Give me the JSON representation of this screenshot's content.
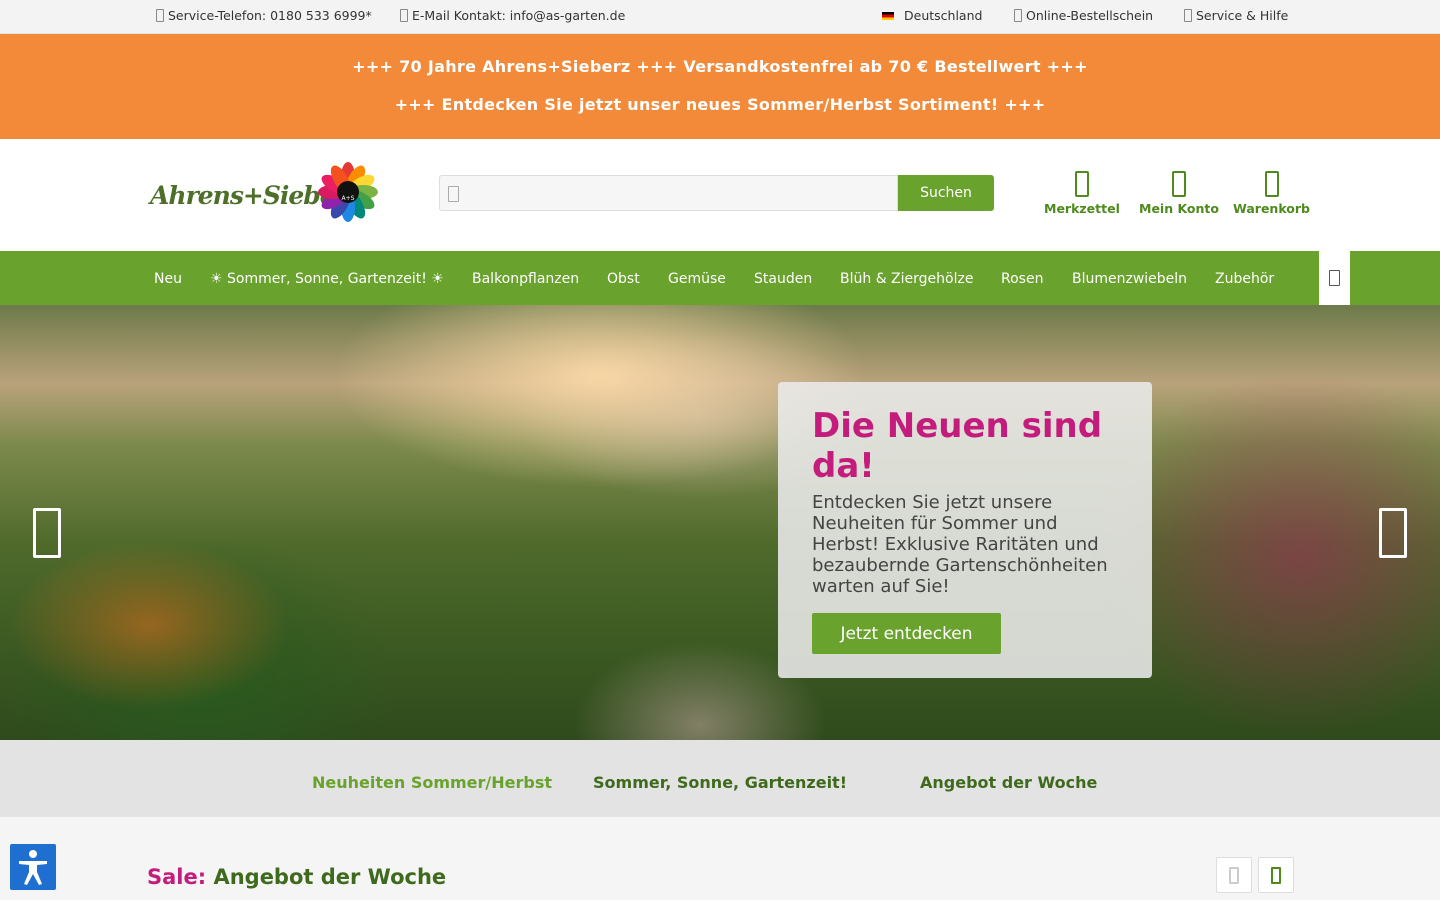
{
  "topbar": {
    "phone": "Service-Telefon: 0180 533 6999*",
    "email": "E-Mail Kontakt: info@as-garten.de",
    "country": "Deutschland",
    "order_form": "Online-Bestellschein",
    "service": "Service & Hilfe"
  },
  "promo": {
    "line1": "+++ 70 Jahre Ahrens+Sieberz +++ Versandkostenfrei ab 70 € Bestellwert +++",
    "line2": "+++ Entdecken Sie jetzt unser neues Sommer/Herbst Sortiment! +++"
  },
  "header": {
    "logo_text": "Ahrens+Sieberz",
    "logo_badge": "A+S",
    "search_placeholder": "",
    "search_button": "Suchen",
    "actions": [
      "Merkzettel",
      "Mein Konto",
      "Warenkorb"
    ]
  },
  "nav": {
    "items": [
      "Neu",
      "☀ Sommer, Sonne, Gartenzeit! ☀",
      "Balkonpflanzen",
      "Obst",
      "Gemüse",
      "Stauden",
      "Blüh & Ziergehölze",
      "Rosen",
      "Blumenzwiebeln",
      "Zubehör"
    ]
  },
  "hero": {
    "title": "Die Neuen sind da!",
    "text": "Entdecken Sie jetzt unsere Neuheiten für Sommer und Herbst! Exklusive Raritäten und bezaubernde Gartenschönheiten warten auf Sie!",
    "button": "Jetzt entdecken"
  },
  "teasers": [
    "Neuheiten Sommer/Herbst",
    "Sommer, Sonne, Gartenzeit!",
    "Angebot der Woche"
  ],
  "section": {
    "sale_label": "Sale:",
    "title": "Angebot der Woche"
  },
  "colors": {
    "brand_green": "#6aa22e",
    "dark_green": "#3f6a1d",
    "promo_orange": "#f28a3a",
    "accent_magenta": "#c41c7c",
    "a11y_blue": "#1f6fd1"
  }
}
